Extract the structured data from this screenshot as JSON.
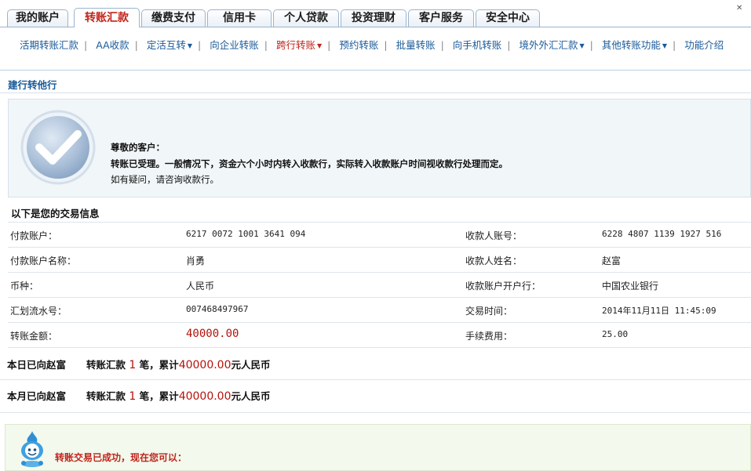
{
  "tabs": [
    {
      "label": "我的账户",
      "active": false
    },
    {
      "label": "转账汇款",
      "active": true
    },
    {
      "label": "缴费支付",
      "active": false
    },
    {
      "label": "信用卡",
      "active": false
    },
    {
      "label": "个人贷款",
      "active": false
    },
    {
      "label": "投资理财",
      "active": false
    },
    {
      "label": "客户服务",
      "active": false
    },
    {
      "label": "安全中心",
      "active": false
    }
  ],
  "subnav": [
    {
      "label": "活期转账汇款",
      "dropdown": false
    },
    {
      "label": "AA收款",
      "dropdown": false
    },
    {
      "label": "定活互转",
      "dropdown": true
    },
    {
      "label": "向企业转账",
      "dropdown": false
    },
    {
      "label": "跨行转账",
      "dropdown": true,
      "active": true
    },
    {
      "label": "预约转账",
      "dropdown": false
    },
    {
      "label": "批量转账",
      "dropdown": false
    },
    {
      "label": "向手机转账",
      "dropdown": false
    },
    {
      "label": "境外外汇汇款",
      "dropdown": true
    },
    {
      "label": "其他转账功能",
      "dropdown": true
    },
    {
      "label": "功能介绍",
      "dropdown": false
    }
  ],
  "section_title": "建行转他行",
  "notice": {
    "greeting": "尊敬的客户：",
    "message": "转账已受理。一般情况下，资金六个小时内转入收款行，实际转入收款账户时间视收款行处理而定。",
    "hint": "如有疑问，请咨询收款行。"
  },
  "info": {
    "title": "以下是您的交易信息",
    "rows": [
      {
        "l1": "付款账户：",
        "v1": "6217 0072 1001 3641 094",
        "l2": "收款人账号：",
        "v2": "6228 4807 1139 1927 516"
      },
      {
        "l1": "付款账户名称：",
        "v1": "肖勇",
        "l2": "收款人姓名：",
        "v2": "赵富"
      },
      {
        "l1": "币种：",
        "v1": "人民币",
        "l2": "收款账户开户行：",
        "v2": "中国农业银行"
      },
      {
        "l1": "汇划流水号：",
        "v1": "007468497967",
        "l2": "交易时间：",
        "v2": "2014年11月11日 11:45:09"
      },
      {
        "l1": "转账金额：",
        "v1": "40000.00",
        "l2": "手续费用：",
        "v2": "25.00"
      }
    ]
  },
  "summary": {
    "today": {
      "prefix": "本日已向赵富",
      "type": "转账汇款",
      "count": "1",
      "mid": "笔，累计",
      "amount": "40000.00",
      "suffix": "元人民币"
    },
    "month": {
      "prefix": "本月已向赵富",
      "type": "转账汇款",
      "count": "1",
      "mid": "笔，累计",
      "amount": "40000.00",
      "suffix": "元人民币"
    }
  },
  "success": {
    "text": "转账交易已成功，现在您可以："
  },
  "colors": {
    "accent_red": "#c0251c",
    "link_blue": "#1a5a99",
    "amount_red": "#b5120b"
  }
}
